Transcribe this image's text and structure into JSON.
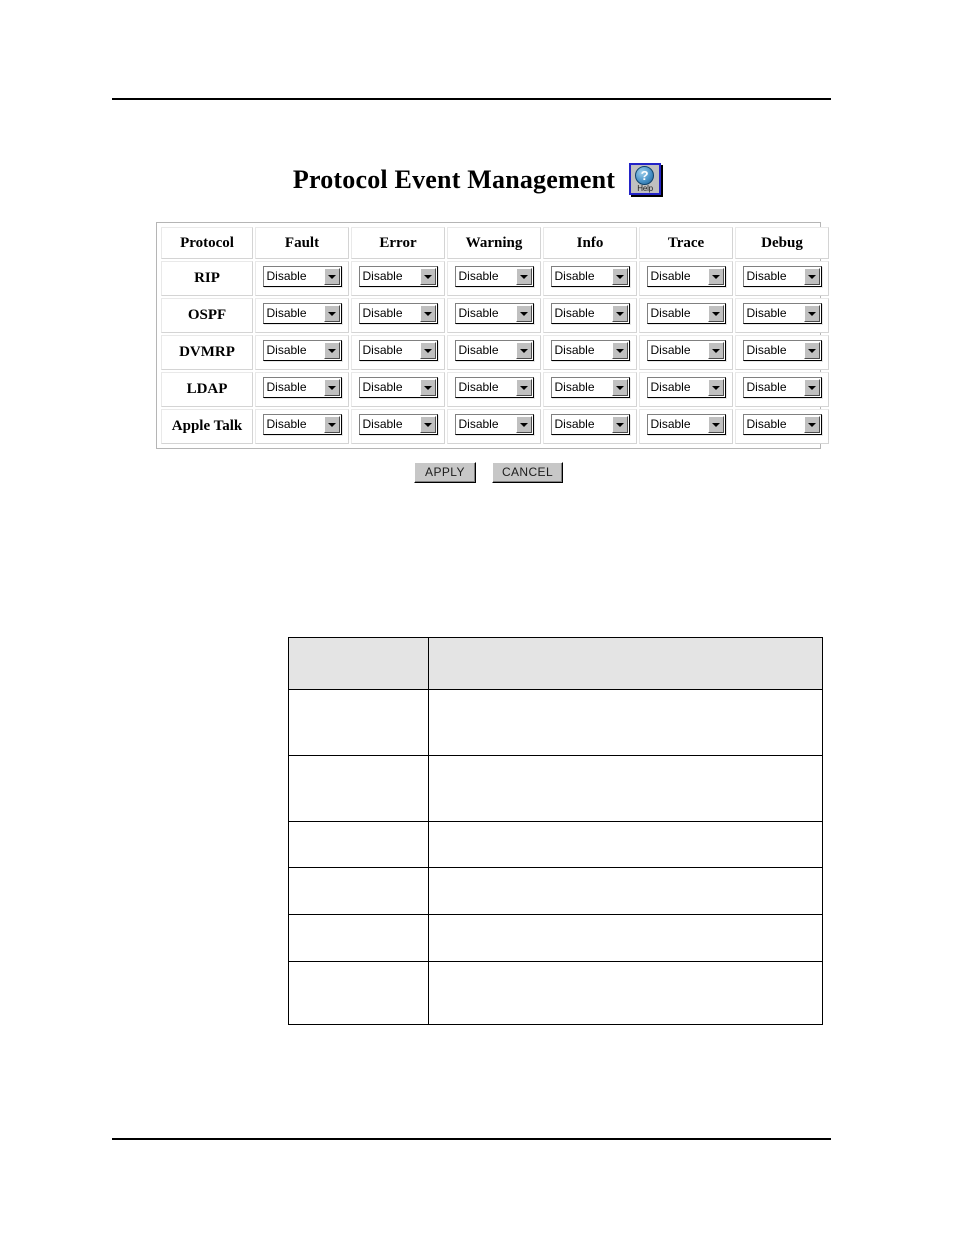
{
  "page": {
    "title": "Protocol Event Management",
    "help_icon": "help-icon",
    "help_badge_glyph": "?",
    "help_caption": "Help"
  },
  "protocol_table": {
    "columns": [
      "Protocol",
      "Fault",
      "Error",
      "Warning",
      "Info",
      "Trace",
      "Debug"
    ],
    "severity_columns": [
      "Fault",
      "Error",
      "Warning",
      "Info",
      "Trace",
      "Debug"
    ],
    "rows": [
      {
        "protocol": "RIP",
        "fault": "Disable",
        "error": "Disable",
        "warning": "Disable",
        "info": "Disable",
        "trace": "Disable",
        "debug": "Disable"
      },
      {
        "protocol": "OSPF",
        "fault": "Disable",
        "error": "Disable",
        "warning": "Disable",
        "info": "Disable",
        "trace": "Disable",
        "debug": "Disable"
      },
      {
        "protocol": "DVMRP",
        "fault": "Disable",
        "error": "Disable",
        "warning": "Disable",
        "info": "Disable",
        "trace": "Disable",
        "debug": "Disable"
      },
      {
        "protocol": "LDAP",
        "fault": "Disable",
        "error": "Disable",
        "warning": "Disable",
        "info": "Disable",
        "trace": "Disable",
        "debug": "Disable"
      },
      {
        "protocol": "Apple Talk",
        "fault": "Disable",
        "error": "Disable",
        "warning": "Disable",
        "info": "Disable",
        "trace": "Disable",
        "debug": "Disable"
      }
    ]
  },
  "actions": {
    "apply_label": "APPLY",
    "cancel_label": "CANCEL"
  },
  "description_table": {
    "header": [
      "",
      ""
    ],
    "rows": [
      [
        "",
        ""
      ],
      [
        "",
        ""
      ],
      [
        "",
        ""
      ],
      [
        "",
        ""
      ],
      [
        "",
        ""
      ],
      [
        "",
        ""
      ]
    ]
  },
  "colors": {
    "help_border": "#2323c8",
    "help_face": "#c0c0c0",
    "button_face": "#c7c7c7",
    "desc_header_fill": "#e4e4e4",
    "rule": "#000000"
  }
}
